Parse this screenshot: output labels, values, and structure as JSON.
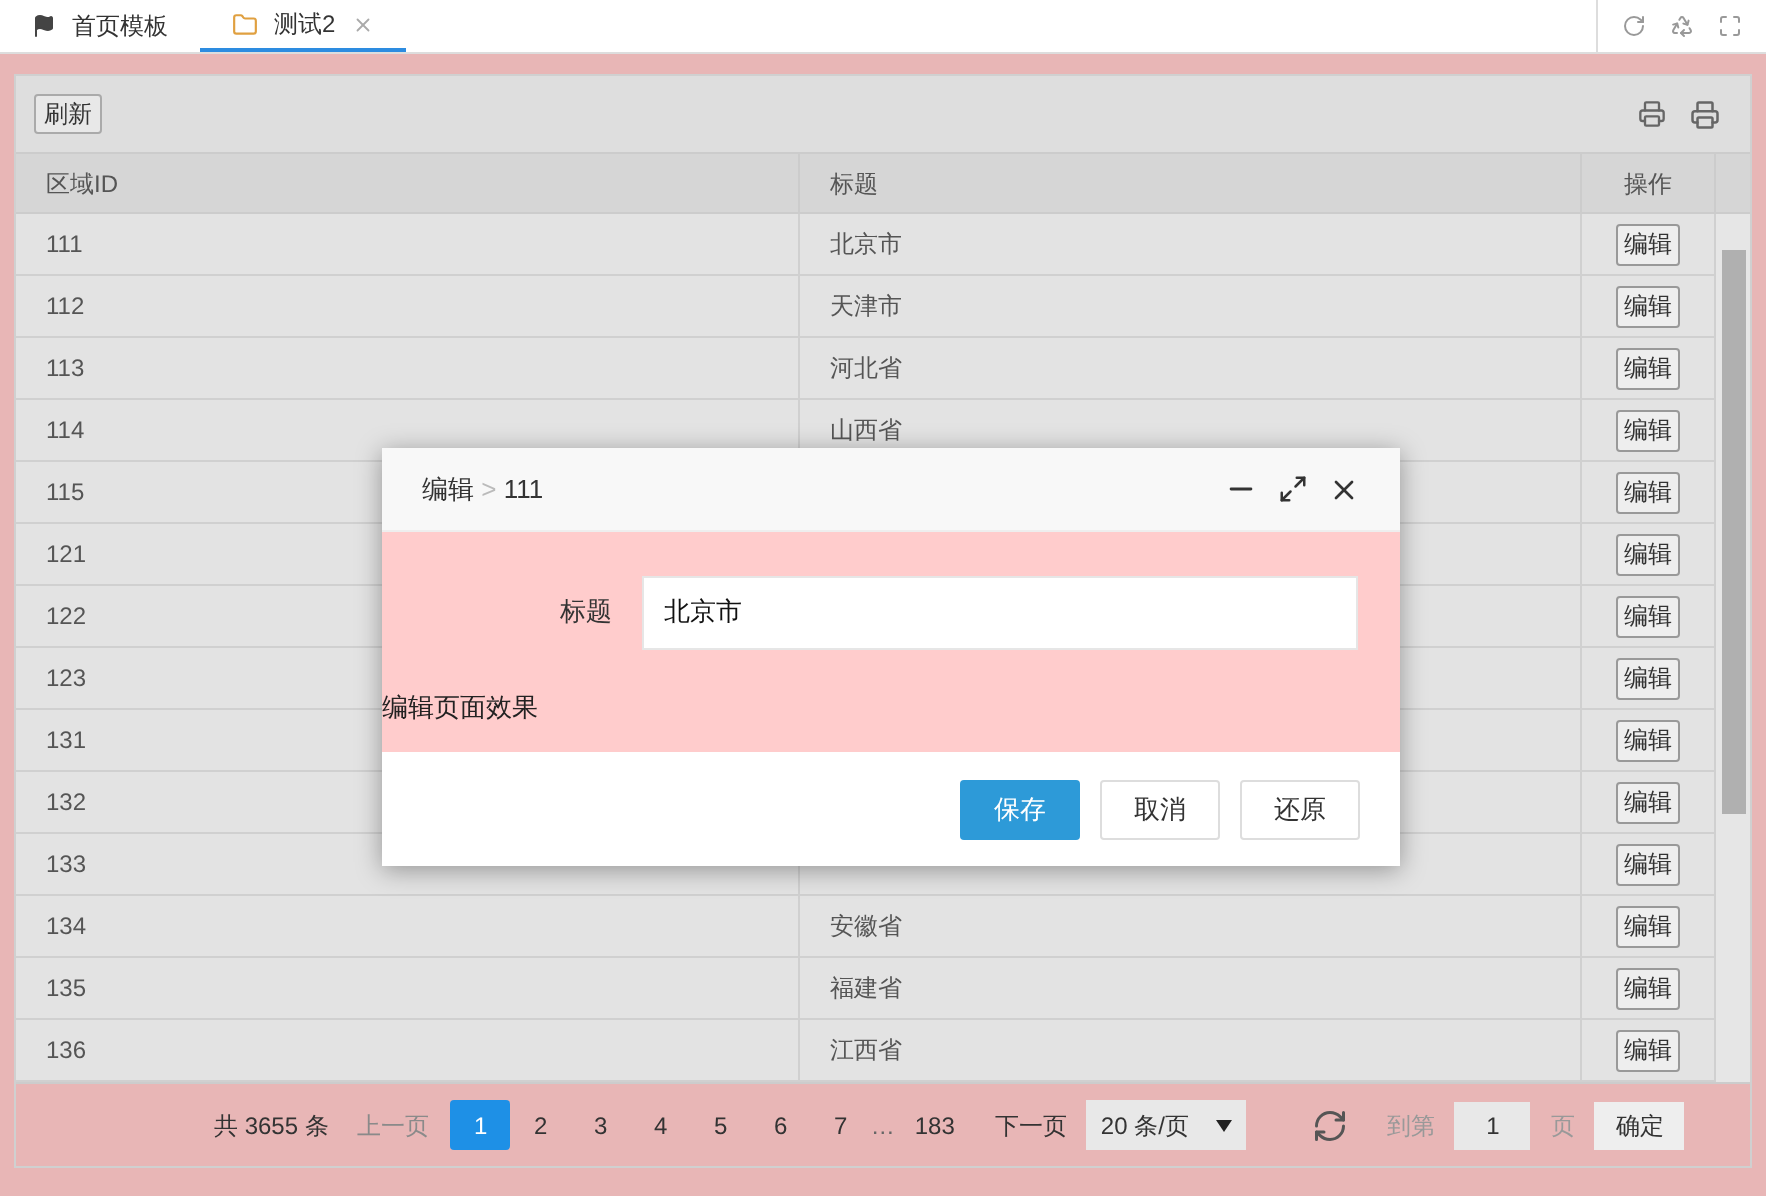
{
  "tabs": [
    {
      "label": "首页模板",
      "kind": "home",
      "selected": false
    },
    {
      "label": "测试2",
      "kind": "page",
      "selected": true
    }
  ],
  "toolbar": {
    "refresh": "刷新"
  },
  "table": {
    "columns": [
      "区域ID",
      "标题",
      "操作"
    ],
    "rows": [
      {
        "id": "111",
        "title": "北京市",
        "action": "编辑"
      },
      {
        "id": "112",
        "title": "天津市",
        "action": "编辑"
      },
      {
        "id": "113",
        "title": "河北省",
        "action": "编辑"
      },
      {
        "id": "114",
        "title": "山西省",
        "action": "编辑"
      },
      {
        "id": "115",
        "action": "编辑"
      },
      {
        "id": "121",
        "action": "编辑"
      },
      {
        "id": "122",
        "action": "编辑"
      },
      {
        "id": "123",
        "action": "编辑"
      },
      {
        "id": "131",
        "action": "编辑"
      },
      {
        "id": "132",
        "action": "编辑"
      },
      {
        "id": "133",
        "action": "编辑"
      },
      {
        "id": "134",
        "title": "安徽省",
        "action": "编辑"
      },
      {
        "id": "135",
        "title": "福建省",
        "action": "编辑"
      },
      {
        "id": "136",
        "title": "江西省",
        "action": "编辑"
      }
    ]
  },
  "pagination": {
    "total": "共 3655 条",
    "prev": "上一页",
    "pages": [
      {
        "label": "1",
        "selected": true
      },
      {
        "label": "2",
        "selected": false
      },
      {
        "label": "3",
        "selected": false
      },
      {
        "label": "4",
        "selected": false
      },
      {
        "label": "5",
        "selected": false
      },
      {
        "label": "6",
        "selected": false
      },
      {
        "label": "7",
        "selected": false
      }
    ],
    "ellipsis": "…",
    "last": "183",
    "next": "下一页",
    "page_size": "20 条/页",
    "goto_label": "到第",
    "goto_value": "1",
    "page_unit": "页",
    "confirm": "确定"
  },
  "dialog": {
    "title": "编辑",
    "separator": ">",
    "subtitle": "111",
    "field_label": "标题",
    "field_value": "北京市",
    "note": "编辑页面效果",
    "buttons": [
      {
        "label": "保存",
        "kind": "primary"
      },
      {
        "label": "取消",
        "kind": "default"
      },
      {
        "label": "还原",
        "kind": "default"
      }
    ]
  }
}
